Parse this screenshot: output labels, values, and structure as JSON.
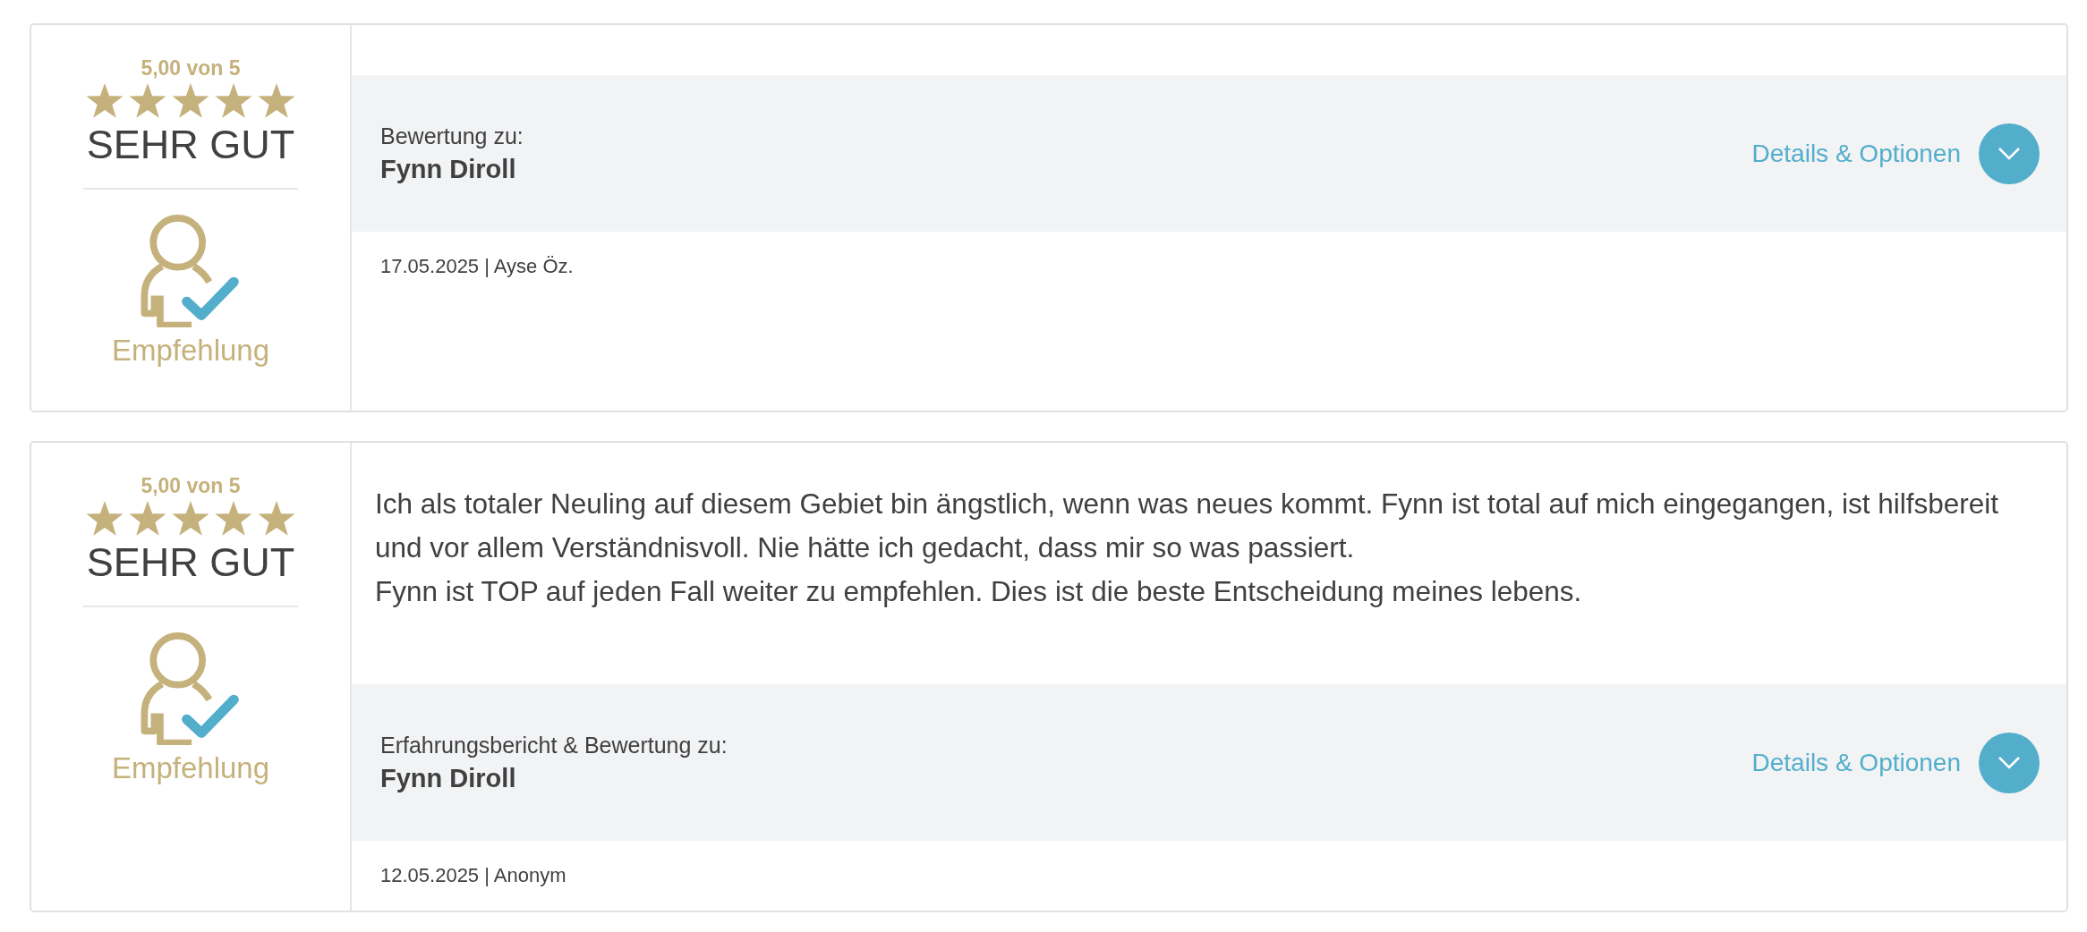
{
  "reviews": [
    {
      "score": "5,00 von 5",
      "stars": 5,
      "verdict": "SEHR GUT",
      "recommendation": "Empfehlung",
      "subject_label": "Bewertung zu:",
      "subject_name": "Fynn Diroll",
      "details_link": "Details & Optionen",
      "expanded": false,
      "meta": "17.05.2025 | Ayse Öz."
    },
    {
      "score": "5,00 von 5",
      "stars": 5,
      "verdict": "SEHR GUT",
      "recommendation": "Empfehlung",
      "body": "Ich als totaler Neuling auf diesem Gebiet bin ängstlich, wenn was neues kommt. Fynn ist total auf mich eingegangen, ist hilfsbereit und vor allem Verständnisvoll. Nie hätte ich gedacht, dass mir so was passiert.\nFynn ist TOP auf jeden Fall weiter zu empfehlen. Dies ist die beste Entscheidung meines lebens.",
      "subject_label": "Erfahrungsbericht & Bewertung zu:",
      "subject_name": "Fynn Diroll",
      "details_link": "Details & Optionen",
      "expanded": false,
      "meta": "12.05.2025 | Anonym"
    }
  ]
}
